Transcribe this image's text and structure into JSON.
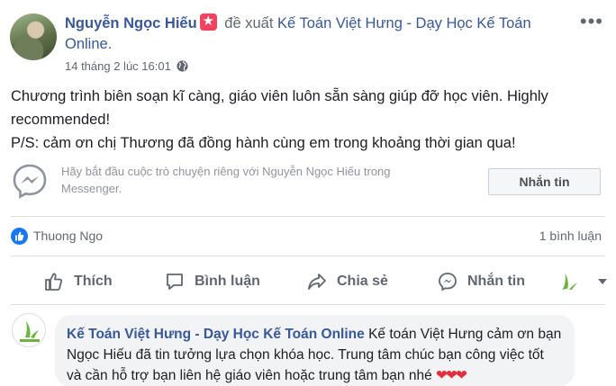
{
  "post": {
    "author": "Nguyễn Ngọc Hiếu",
    "verb": "đề xuất",
    "page": "Kế Toán Việt Hưng - Dạy Học Kế Toán Online.",
    "timestamp": "14 tháng 2 lúc 16:01",
    "privacy_icon": "globe-icon",
    "more_label": "•••",
    "body_line1": "Chương trình biên soạn kĩ càng, giáo viên luôn sẵn sàng giúp đỡ học viên. Highly recommended!",
    "body_line2": "P/S: cảm ơn chị Thương đã đồng hành cùng em trong khoảng thời gian qua!"
  },
  "messenger_prompt": {
    "text": "Hãy bắt đầu cuộc trò chuyện riêng với Nguyễn Ngọc Hiếu trong Messenger.",
    "button_label": "Nhắn tin"
  },
  "reactions": {
    "reactor": "Thuong Ngo",
    "comment_count": "1 bình luận"
  },
  "actions": {
    "like": "Thích",
    "comment": "Bình luận",
    "share": "Chia sẻ",
    "message": "Nhắn tin"
  },
  "comment": {
    "author": "Kế Toán Việt Hưng - Dạy Học Kế Toán Online",
    "text": "Kế toán Việt Hưng cảm ơn bạn Ngọc Hiếu đã tin tưởng lựa chọn khóa học. Trung tâm chúc bạn công việc tốt và cần hỗ trợ bạn liên hệ giáo viên hoặc trung tâm bạn nhé",
    "hearts": "❤❤❤"
  },
  "colors": {
    "link": "#385898",
    "secondary_text": "#606770",
    "like_blue": "#1877f2",
    "badge_red": "#f3425f",
    "heart_red": "#e0303e"
  }
}
